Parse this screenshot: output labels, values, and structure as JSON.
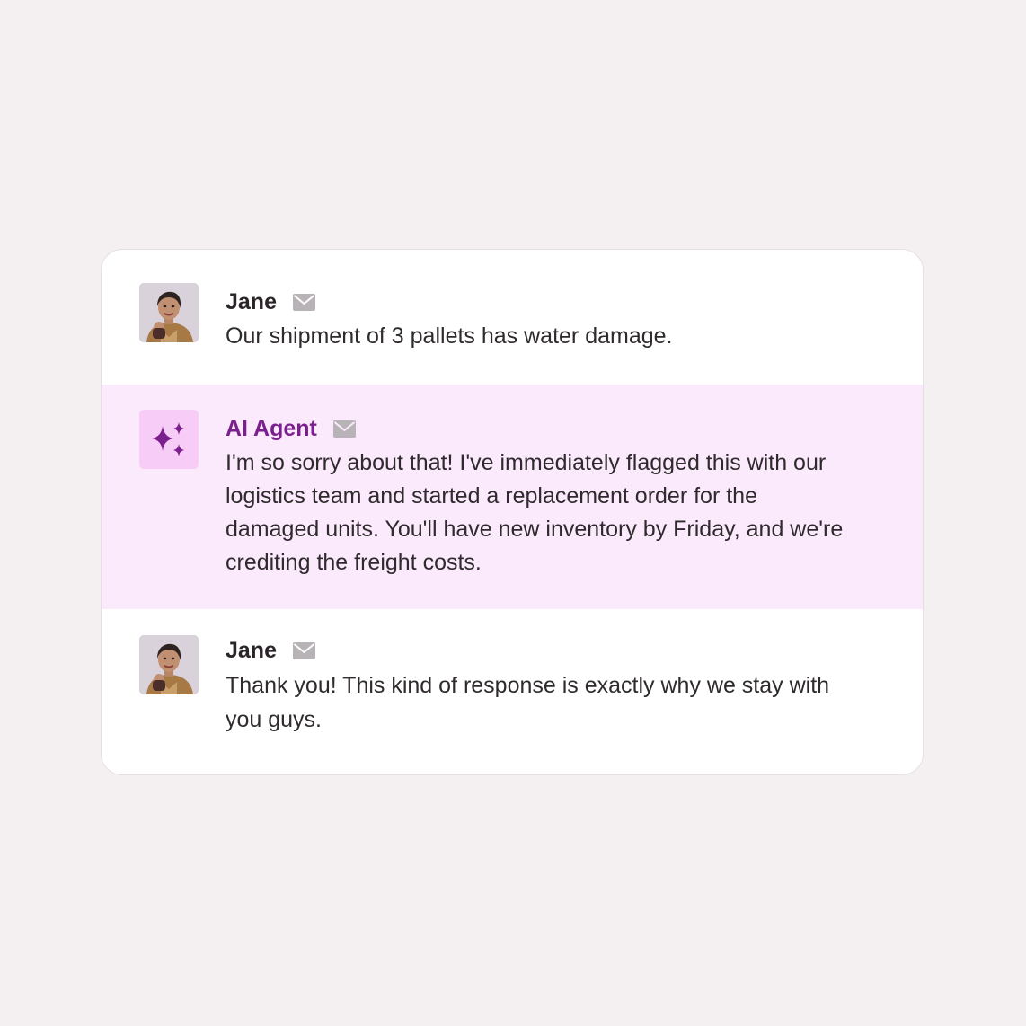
{
  "messages": [
    {
      "sender": "Jane",
      "avatar": "user-photo",
      "channel_icon": "mail-icon",
      "text": "Our shipment of 3 pallets has water damage."
    },
    {
      "sender": "AI Agent",
      "avatar": "sparkles-icon",
      "channel_icon": "mail-icon",
      "text": "I'm so sorry about that! I've immediately flagged this with our logistics team and started a replacement order for the damaged units. You'll have new inventory by Friday, and we're crediting the freight costs."
    },
    {
      "sender": "Jane",
      "avatar": "user-photo",
      "channel_icon": "mail-icon",
      "text": "Thank you! This kind of response is exactly why we stay with you guys."
    }
  ],
  "colors": {
    "page_background": "#f4f0f1",
    "card_background": "#ffffff",
    "agent_row_background": "#fbeafc",
    "agent_accent": "#7a1f8d",
    "agent_avatar_background": "#f7cdf8",
    "mail_icon": "#b8b3b6",
    "text": "#2f2a2d"
  }
}
